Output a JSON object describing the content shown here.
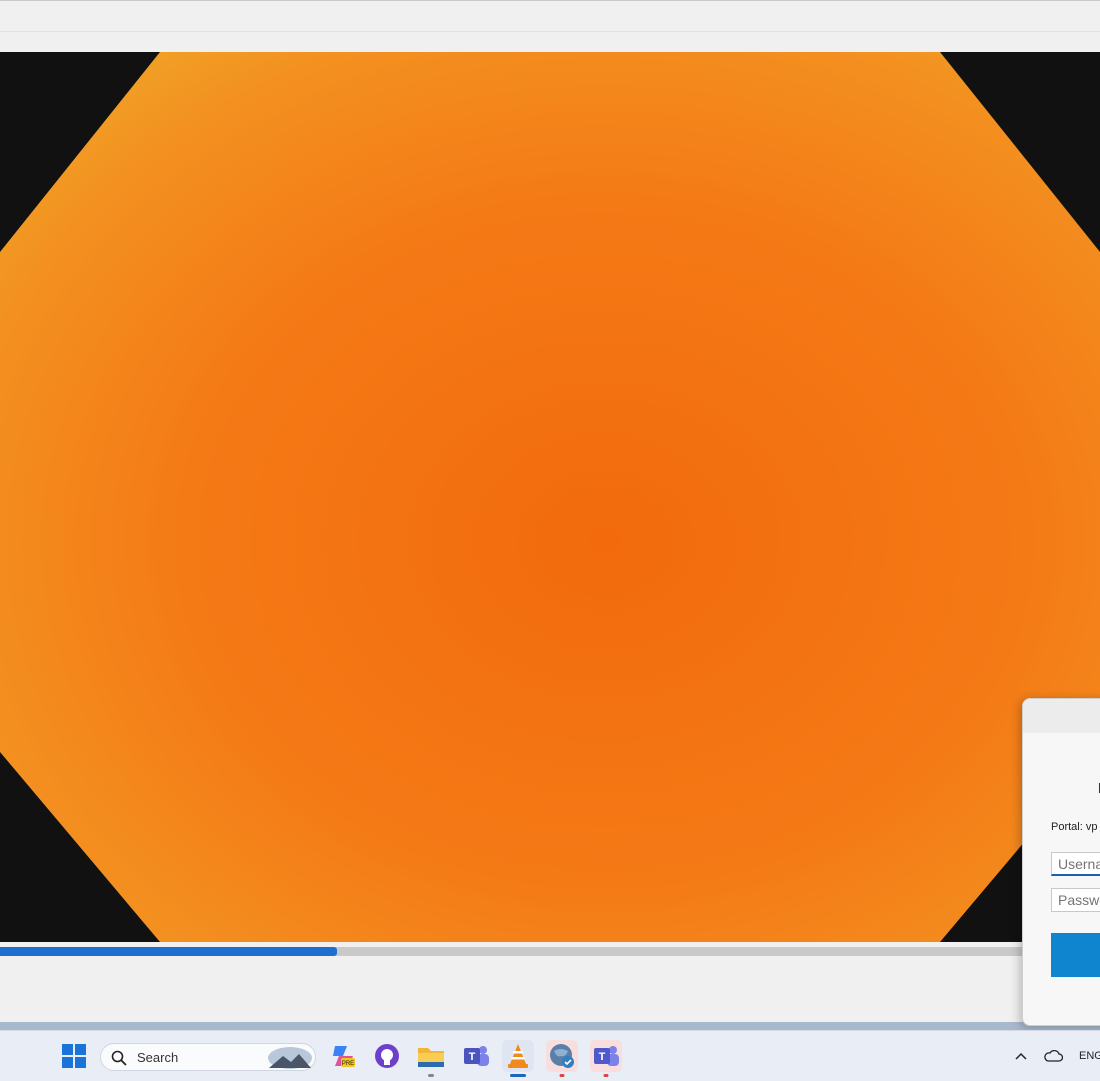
{
  "player": {
    "progress_fraction": 0.306,
    "accent_color": "#1f6fcf"
  },
  "login_dialog": {
    "portal_label": "Portal: vp",
    "username_placeholder": "Userna",
    "password_placeholder": "Passwo"
  },
  "taskbar": {
    "search_label": "Search",
    "apps": [
      {
        "icon": "windows-start-icon"
      },
      {
        "icon": "search-icon"
      },
      {
        "icon": "copilot-pre-icon"
      },
      {
        "icon": "github-desktop-icon"
      },
      {
        "icon": "file-explorer-icon"
      },
      {
        "icon": "teams-classic-icon"
      },
      {
        "icon": "vlc-icon"
      },
      {
        "icon": "globalprotect-icon"
      },
      {
        "icon": "teams-icon"
      }
    ],
    "tray": {
      "language": "ENG",
      "icons": [
        "chevron-up-icon",
        "onedrive-cloud-icon"
      ]
    }
  }
}
